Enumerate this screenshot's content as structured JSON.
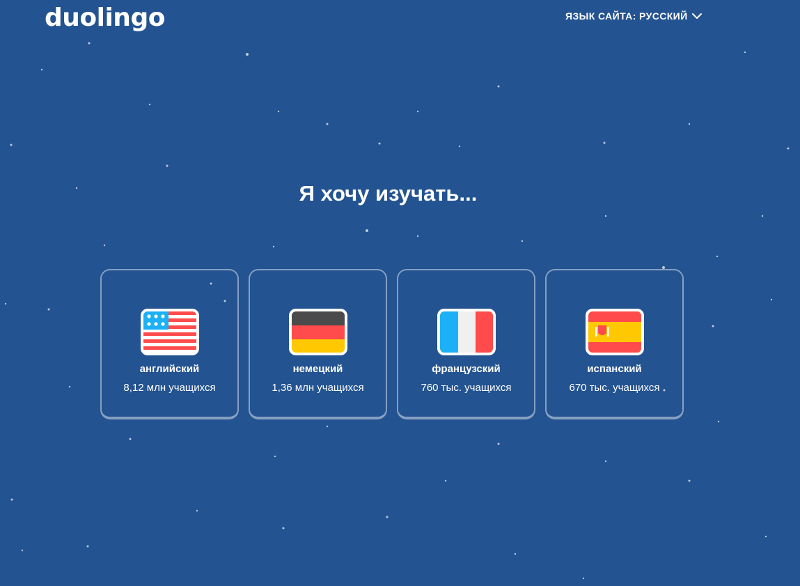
{
  "header": {
    "logo": "duolingo",
    "site_language_label": "ЯЗЫК САЙТА: РУССКИЙ"
  },
  "main": {
    "headline": "Я хочу изучать...",
    "languages": [
      {
        "name": "английский",
        "learners": "8,12 млн учащихся",
        "flag_icon": "usa-flag-icon"
      },
      {
        "name": "немецкий",
        "learners": "1,36 млн учащихся",
        "flag_icon": "germany-flag-icon"
      },
      {
        "name": "французский",
        "learners": "760 тыс. учащихся",
        "flag_icon": "france-flag-icon"
      },
      {
        "name": "испанский",
        "learners": "670 тыс. учащихся",
        "flag_icon": "spain-flag-icon"
      }
    ]
  },
  "colors": {
    "background": "#235390",
    "text": "#ffffff",
    "card_border": "rgba(255,255,255,0.45)"
  }
}
